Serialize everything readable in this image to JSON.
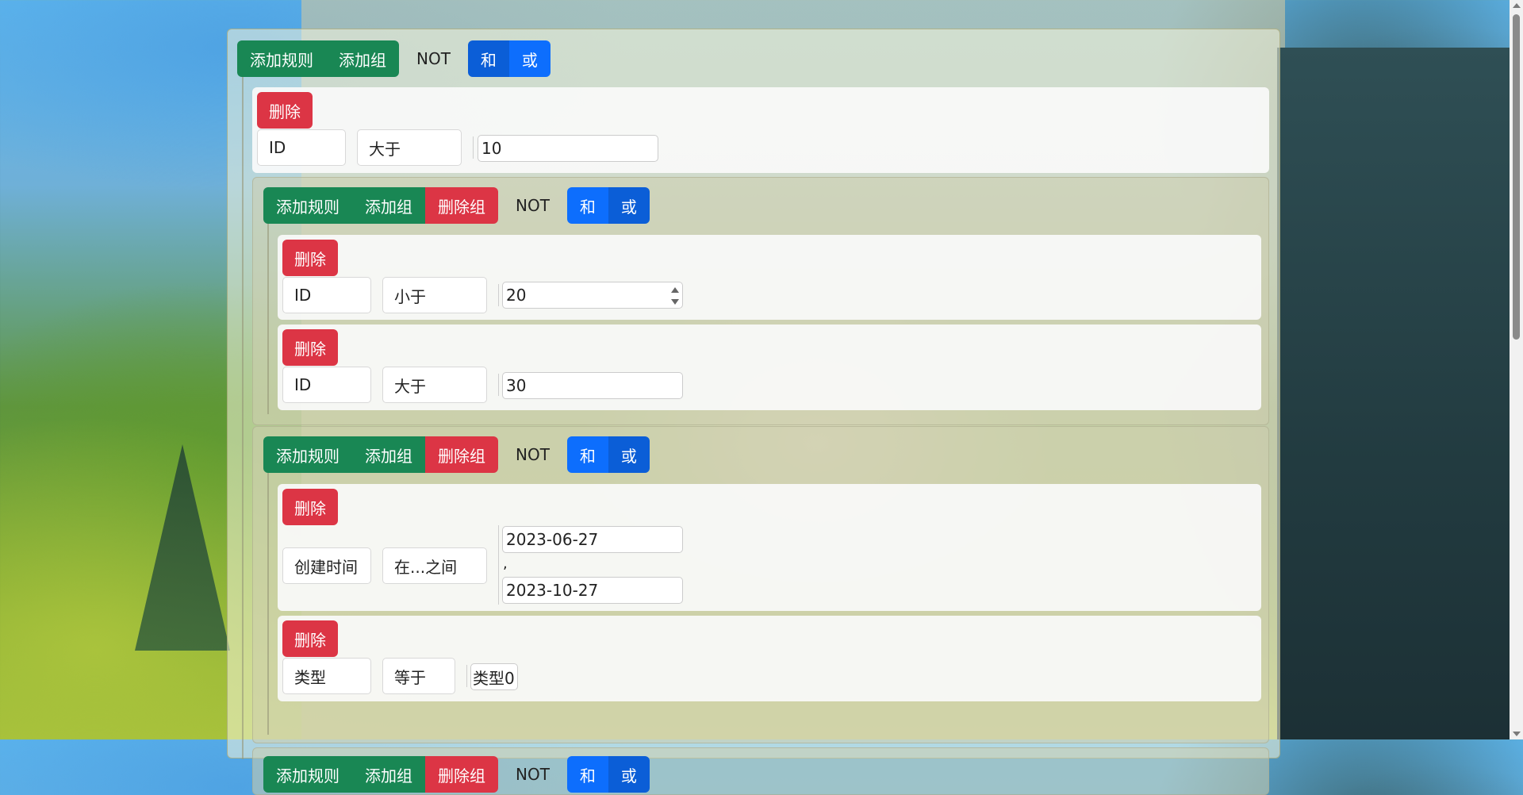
{
  "toolbar": {
    "add_rule": "添加规则",
    "add_group": "添加组",
    "delete_group": "删除组",
    "not_label": "NOT",
    "and_label": "和",
    "or_label": "或"
  },
  "rule_delete_label": "删除",
  "root_rule": {
    "field": "ID",
    "operator": "大于",
    "value": "10"
  },
  "group1": {
    "rule1": {
      "field": "ID",
      "operator": "小于",
      "value": "20"
    },
    "rule2": {
      "field": "ID",
      "operator": "大于",
      "value": "30"
    }
  },
  "group2": {
    "rule1": {
      "field": "创建时间",
      "operator": "在...之间",
      "value_from": "2023-06-27",
      "separator": ",",
      "value_to": "2023-10-27"
    },
    "rule2": {
      "field": "类型",
      "operator": "等于",
      "value": "类型0"
    }
  },
  "colors": {
    "success": "#198754",
    "danger": "#dc3545",
    "primary": "#0d6efd"
  }
}
